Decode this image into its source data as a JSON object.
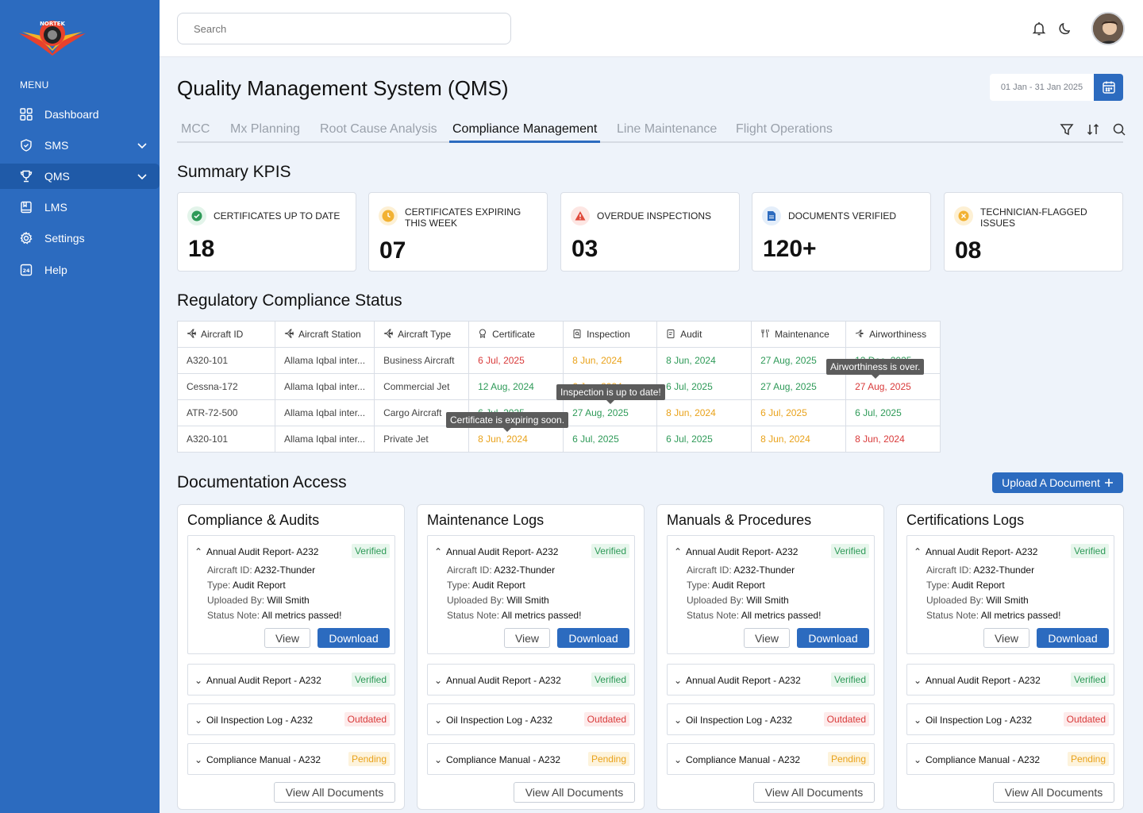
{
  "sidebar": {
    "logo_text": "NORTEK",
    "menu_label": "MENU",
    "items": [
      {
        "label": "Dashboard"
      },
      {
        "label": "SMS"
      },
      {
        "label": "QMS"
      },
      {
        "label": "LMS"
      },
      {
        "label": "Settings"
      },
      {
        "label": "Help"
      }
    ],
    "active_item": "QMS",
    "color": "#2c6bbf"
  },
  "topbar": {
    "search_placeholder": "Search",
    "icons": [
      "bell-icon",
      "moon-icon",
      "avatar"
    ]
  },
  "header": {
    "title": "Quality Management System (QMS)",
    "date_range": "01 Jan - 31 Jan 2025"
  },
  "tabs": [
    "MCC",
    "Mx Planning",
    "Root Cause Analysis",
    "Compliance Management",
    "Line Maintenance",
    "Flight Operations"
  ],
  "active_tab": "Compliance Management",
  "summary": {
    "title": "Summary KPIS",
    "kpis": [
      {
        "label": "CERTIFICATES UP TO DATE",
        "value": "18",
        "icon": "check-icon",
        "color": "#2e9a58"
      },
      {
        "label": "CERTIFICATES EXPIRING THIS WEEK",
        "value": "07",
        "icon": "clock-icon",
        "color": "#f2b233"
      },
      {
        "label": "OVERDUE INSPECTIONS",
        "value": "03",
        "icon": "warning-icon",
        "color": "#e04a3c"
      },
      {
        "label": "DOCUMENTS VERIFIED",
        "value": "120+",
        "icon": "document-icon",
        "color": "#2c6bbf"
      },
      {
        "label": "TECHNICIAN-FLAGGED ISSUES",
        "value": "08",
        "icon": "flag-x-icon",
        "color": "#f2b233"
      }
    ]
  },
  "compliance": {
    "title": "Regulatory Compliance Status",
    "headers": [
      "Aircraft ID",
      "Aircraft Station",
      "Aircraft Type",
      "Certificate",
      "Inspection",
      "Audit",
      "Maintenance",
      "Airworthiness"
    ],
    "rows": [
      {
        "id": "A320-101",
        "station": "Allama Iqbal inter...",
        "type": "Business Aircraft",
        "certificate": "6 Jul, 2025",
        "inspection": "8 Jun, 2024",
        "audit": "8 Jun, 2024",
        "maintenance": "27 Aug, 2025",
        "airworthiness": "12 Dec, 2025"
      },
      {
        "id": "Cessna-172",
        "station": "Allama Iqbal inter...",
        "type": "Commercial Jet",
        "certificate": "12 Aug, 2024",
        "inspection": "6 Jun, 2024",
        "audit": "6 Jul, 2025",
        "maintenance": "27 Aug, 2025",
        "airworthiness": "27 Aug, 2025"
      },
      {
        "id": "ATR-72-500",
        "station": "Allama Iqbal inter...",
        "type": "Cargo Aircraft",
        "certificate": "6 Jul, 2025",
        "inspection": "27 Aug, 2025",
        "audit": "8 Jun, 2024",
        "maintenance": "6 Jul, 2025",
        "airworthiness": "6 Jul, 2025"
      },
      {
        "id": "A320-101",
        "station": "Allama Iqbal inter...",
        "type": "Private Jet",
        "certificate": "8 Jun, 2024",
        "inspection": "6 Jul, 2025",
        "audit": "6 Jul, 2025",
        "maintenance": "8 Jun, 2024",
        "airworthiness": "8 Jun, 2024"
      }
    ],
    "tooltips": {
      "airworthiness": "Airworthiness is over.",
      "inspection": "Inspection is up to date!",
      "certificate": "Certificate is expiring soon."
    },
    "status_colors": {
      "ok": "#2e9a58",
      "overdue": "#d93a3a",
      "expiring": "#e9a21a"
    }
  },
  "documentation": {
    "title": "Documentation Access",
    "upload_label": "Upload A Document",
    "panels": [
      {
        "title": "Compliance & Audits"
      },
      {
        "title": "Maintenance Logs"
      },
      {
        "title": "Manuals & Procedures"
      },
      {
        "title": "Certifications Logs"
      }
    ],
    "open_doc": {
      "name": "Annual Audit Report- A232",
      "status": "Verified",
      "aircraft_label": "Aircraft ID:",
      "aircraft_value": "A232-Thunder",
      "type_label": "Type:",
      "type_value": "Audit Report",
      "uploaded_label": "Uploaded By:",
      "uploaded_value": "Will Smith",
      "note_label": "Status Note:",
      "note_value": "All metrics passed!",
      "view_label": "View",
      "download_label": "Download"
    },
    "closed_docs": [
      {
        "name": "Annual Audit Report - A232",
        "status": "Verified"
      },
      {
        "name": "Oil Inspection Log - A232",
        "status": "Outdated"
      },
      {
        "name": "Compliance Manual - A232",
        "status": "Pending"
      }
    ],
    "view_all_label": "View All Documents"
  }
}
